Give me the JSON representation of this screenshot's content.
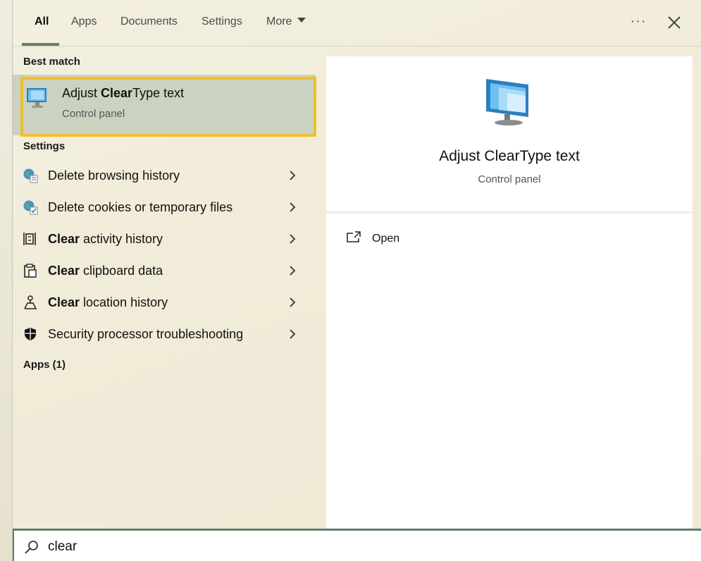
{
  "tabs": [
    {
      "label": "All",
      "active": true
    },
    {
      "label": "Apps"
    },
    {
      "label": "Documents"
    },
    {
      "label": "Settings"
    },
    {
      "label": "More"
    }
  ],
  "header": {
    "ellipsis": "···"
  },
  "sections": {
    "best_match": "Best match",
    "settings": "Settings",
    "apps": "Apps (1)"
  },
  "best_match": {
    "title_prefix": "Adjust ",
    "title_bold": "Clear",
    "title_suffix": "Type text",
    "subtitle": "Control panel",
    "icon": "monitor-icon"
  },
  "settings_items": [
    {
      "bold": "",
      "text": "Delete browsing history",
      "icon": "globe-settings-icon"
    },
    {
      "bold": "",
      "text": "Delete cookies or temporary files",
      "icon": "globe-check-icon"
    },
    {
      "bold": "Clear",
      "text": " activity history",
      "icon": "activity-history-icon"
    },
    {
      "bold": "Clear",
      "text": " clipboard data",
      "icon": "clipboard-icon"
    },
    {
      "bold": "Clear",
      "text": " location history",
      "icon": "location-icon"
    },
    {
      "bold": "",
      "text": "Security processor troubleshooting",
      "icon": "shield-icon"
    }
  ],
  "preview": {
    "title": "Adjust ClearType text",
    "subtitle": "Control panel",
    "open_label": "Open"
  },
  "search": {
    "value": "clear",
    "placeholder": ""
  },
  "colors": {
    "accent": "#5f7f6c",
    "highlight_border": "#f0be2f",
    "selected_bg": "#cbd2bf"
  }
}
